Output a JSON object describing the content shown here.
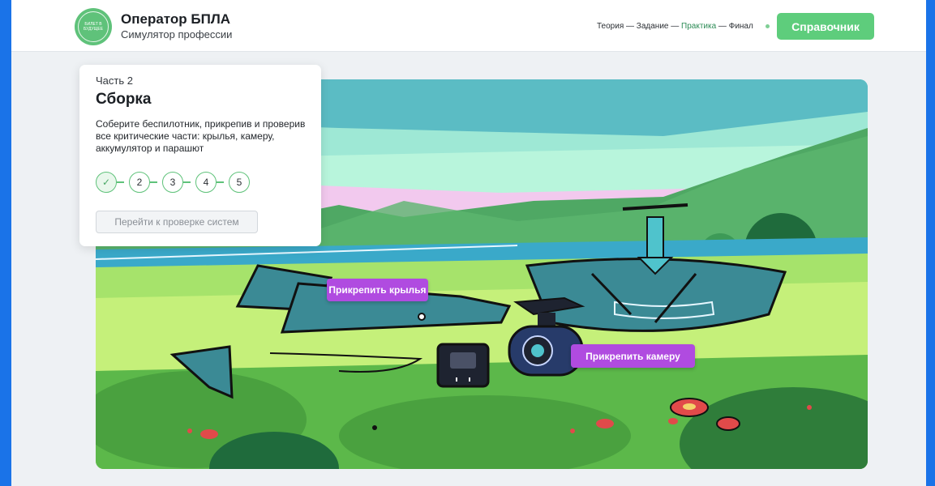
{
  "header": {
    "logo_text": "БИЛЕТ В БУДУЩЕЕ",
    "title": "Оператор БПЛА",
    "subtitle": "Симулятор профессии",
    "nav": {
      "theory": "Теория",
      "task": "Задание",
      "practice": "Практика",
      "final": "Финал",
      "separator": " — "
    },
    "reference_button": "Справочник"
  },
  "card": {
    "part": "Часть 2",
    "heading": "Сборка",
    "description": "Соберите беспилотник, прикрепив и проверив все критические части: крылья, камеру, аккумулятор и парашют",
    "steps": [
      {
        "label": "✓",
        "done": true
      },
      {
        "label": "2",
        "done": false
      },
      {
        "label": "3",
        "done": false
      },
      {
        "label": "4",
        "done": false
      },
      {
        "label": "5",
        "done": false
      }
    ],
    "go_button": "Перейти к проверке систем"
  },
  "scene": {
    "attach_wings": "Прикрепить крылья",
    "attach_camera": "Прикрепить камеру"
  },
  "colors": {
    "accent_green": "#5ecd7c",
    "action_purple": "#b04be0",
    "nav_active": "#2c8b55"
  }
}
